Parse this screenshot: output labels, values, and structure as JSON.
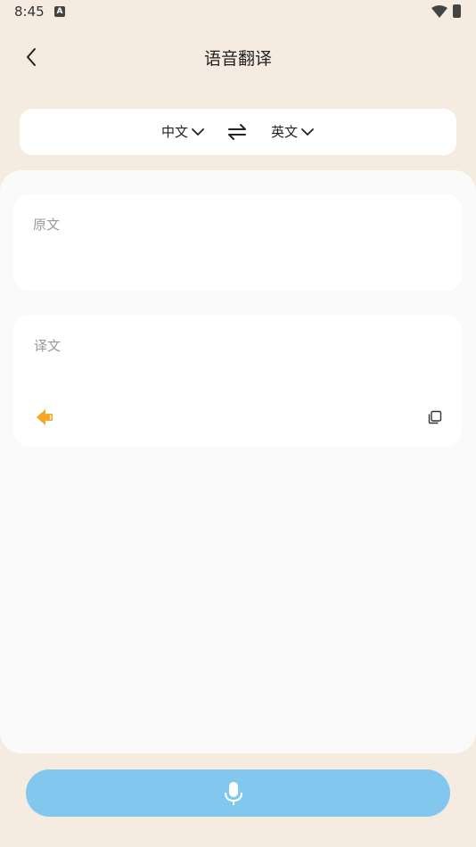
{
  "status": {
    "time": "8:45",
    "badge": "A"
  },
  "header": {
    "title": "语音翻译",
    "back_icon": "back-chevron-icon"
  },
  "languages": {
    "source": "中文",
    "target": "英文",
    "swap_icon": "swap-arrows-icon"
  },
  "source_card": {
    "placeholder": "原文",
    "value": ""
  },
  "target_card": {
    "placeholder": "译文",
    "value": "",
    "speak_icon": "speaker-icon",
    "copy_icon": "copy-icon"
  },
  "mic": {
    "icon": "microphone-icon"
  },
  "colors": {
    "background": "#f5ebe0",
    "accent": "#f5a623",
    "mic_button": "#82c8ee"
  }
}
